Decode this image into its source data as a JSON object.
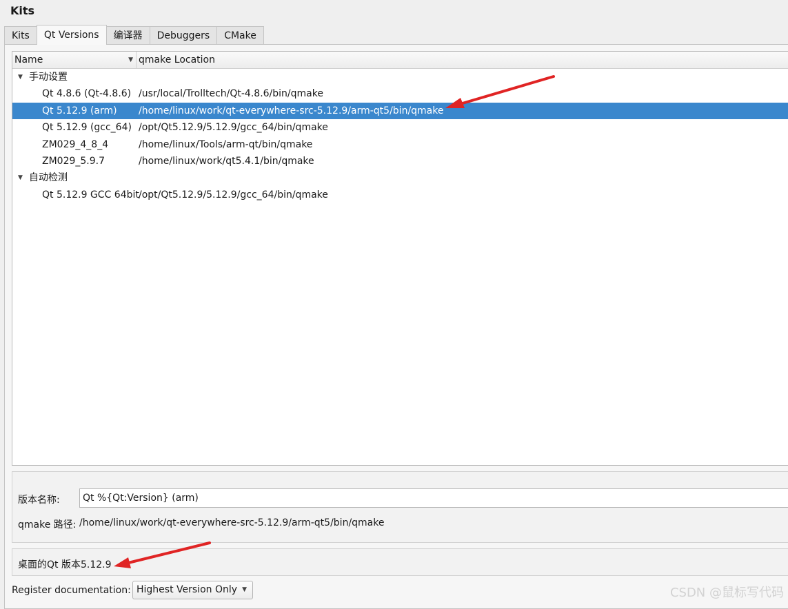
{
  "window": {
    "title": "Kits"
  },
  "tabs": [
    {
      "label": "Kits"
    },
    {
      "label": "Qt Versions"
    },
    {
      "label": "编译器"
    },
    {
      "label": "Debuggers"
    },
    {
      "label": "CMake"
    }
  ],
  "tree": {
    "columns": {
      "name": "Name",
      "location": "qmake Location"
    },
    "groups": [
      {
        "label": "手动设置",
        "items": [
          {
            "name": "Qt 4.8.6 (Qt-4.8.6)",
            "location": "/usr/local/Trolltech/Qt-4.8.6/bin/qmake"
          },
          {
            "name": "Qt 5.12.9 (arm)",
            "location": "/home/linux/work/qt-everywhere-src-5.12.9/arm-qt5/bin/qmake"
          },
          {
            "name": "Qt 5.12.9 (gcc_64)",
            "location": "/opt/Qt5.12.9/5.12.9/gcc_64/bin/qmake"
          },
          {
            "name": "ZM029_4_8_4",
            "location": "/home/linux/Tools/arm-qt/bin/qmake"
          },
          {
            "name": "ZM029_5.9.7",
            "location": "/home/linux/work/qt5.4.1/bin/qmake"
          }
        ]
      },
      {
        "label": "自动检测",
        "items": [
          {
            "name": "Qt 5.12.9 GCC 64bit",
            "location": "/opt/Qt5.12.9/5.12.9/gcc_64/bin/qmake"
          }
        ]
      }
    ]
  },
  "details": {
    "name_label": "版本名称:",
    "name_value": "Qt %{Qt:Version} (arm)",
    "path_label": "qmake 路径:",
    "path_value": "/home/linux/work/qt-everywhere-src-5.12.9/arm-qt5/bin/qmake"
  },
  "info": {
    "text": "桌面的Qt 版本5.12.9"
  },
  "register": {
    "label": "Register documentation:",
    "selected": "Highest Version Only"
  },
  "watermark": "CSDN @鼠标写代码",
  "colors": {
    "selection": "#3a87cd",
    "annotation_arrow": "#e02424"
  },
  "icons": {
    "expand": "triangle-down-icon",
    "sort": "triangle-down-icon",
    "dropdown": "triangle-down-icon",
    "annotation": "red-arrow-icon"
  }
}
